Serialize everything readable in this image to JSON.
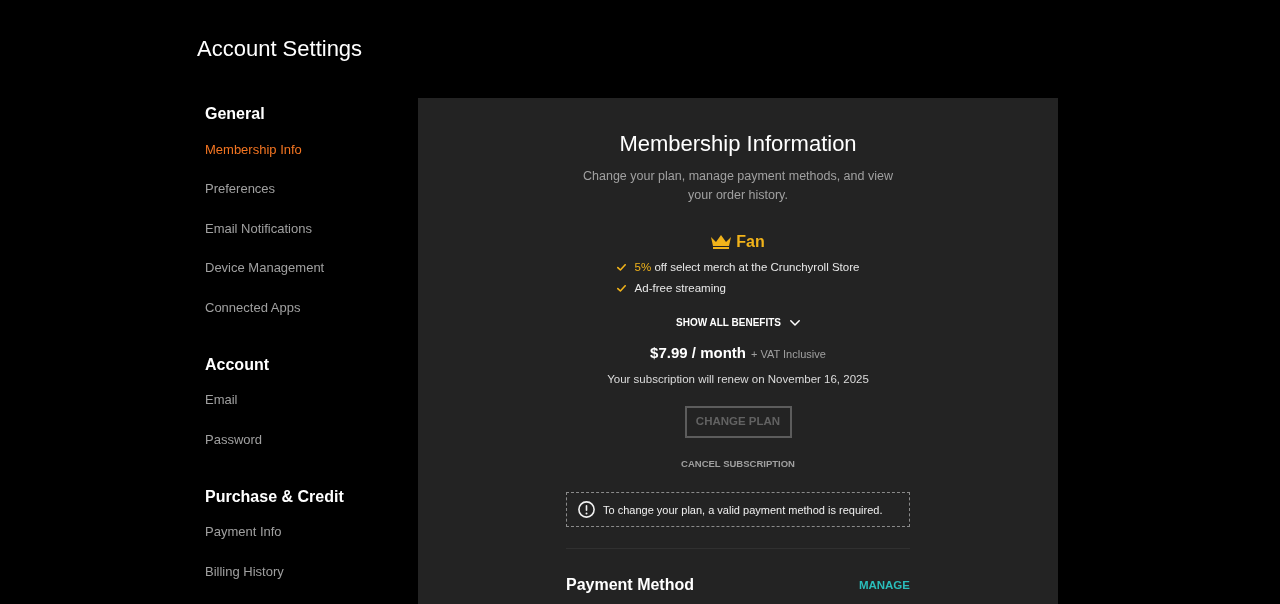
{
  "page_title": "Account Settings",
  "sidebar": {
    "sections": [
      {
        "heading": "General",
        "items": [
          {
            "label": "Membership Info",
            "selected": true
          },
          {
            "label": "Preferences",
            "selected": false
          },
          {
            "label": "Email Notifications",
            "selected": false
          },
          {
            "label": "Device Management",
            "selected": false
          },
          {
            "label": "Connected Apps",
            "selected": false
          }
        ]
      },
      {
        "heading": "Account",
        "items": [
          {
            "label": "Email",
            "selected": false
          },
          {
            "label": "Password",
            "selected": false
          }
        ]
      },
      {
        "heading": "Purchase & Credit",
        "items": [
          {
            "label": "Payment Info",
            "selected": false
          },
          {
            "label": "Billing History",
            "selected": false
          }
        ]
      }
    ]
  },
  "panel": {
    "title": "Membership Information",
    "subtitle": "Change your plan, manage payment methods, and view your order history.",
    "plan": {
      "name": "Fan",
      "benefits": [
        {
          "highlight": "5%",
          "text": "off select merch at the Crunchyroll Store"
        },
        {
          "text": "Ad-free streaming"
        }
      ],
      "show_all": "SHOW ALL BENEFITS",
      "price": "$7.99 / month",
      "tax_note": "+ VAT Inclusive",
      "renewal": "Your subscription will renew on November 16, 2025"
    },
    "change_plan": {
      "label": "CHANGE PLAN",
      "disabled": true
    },
    "cancel": "CANCEL SUBSCRIPTION",
    "notice": "To change your plan, a valid payment method is required.",
    "payment_method": {
      "title": "Payment Method",
      "action": "MANAGE"
    }
  }
}
